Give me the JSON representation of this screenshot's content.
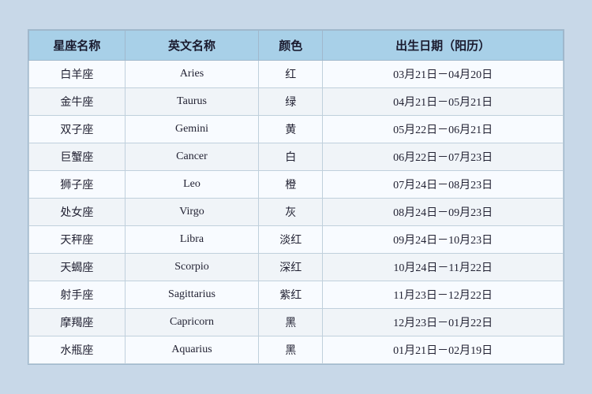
{
  "table": {
    "headers": {
      "name_zh": "星座名称",
      "name_en": "英文名称",
      "color": "颜色",
      "date": "出生日期（阳历）"
    },
    "rows": [
      {
        "name_zh": "白羊座",
        "name_en": "Aries",
        "color": "红",
        "date": "03月21日－04月20日"
      },
      {
        "name_zh": "金牛座",
        "name_en": "Taurus",
        "color": "绿",
        "date": "04月21日－05月21日"
      },
      {
        "name_zh": "双子座",
        "name_en": "Gemini",
        "color": "黄",
        "date": "05月22日－06月21日"
      },
      {
        "name_zh": "巨蟹座",
        "name_en": "Cancer",
        "color": "白",
        "date": "06月22日－07月23日"
      },
      {
        "name_zh": "狮子座",
        "name_en": "Leo",
        "color": "橙",
        "date": "07月24日－08月23日"
      },
      {
        "name_zh": "处女座",
        "name_en": "Virgo",
        "color": "灰",
        "date": "08月24日－09月23日"
      },
      {
        "name_zh": "天秤座",
        "name_en": "Libra",
        "color": "淡红",
        "date": "09月24日－10月23日"
      },
      {
        "name_zh": "天蝎座",
        "name_en": "Scorpio",
        "color": "深红",
        "date": "10月24日－11月22日"
      },
      {
        "name_zh": "射手座",
        "name_en": "Sagittarius",
        "color": "紫红",
        "date": "11月23日－12月22日"
      },
      {
        "name_zh": "摩羯座",
        "name_en": "Capricorn",
        "color": "黑",
        "date": "12月23日－01月22日"
      },
      {
        "name_zh": "水瓶座",
        "name_en": "Aquarius",
        "color": "黑",
        "date": "01月21日－02月19日"
      }
    ]
  }
}
